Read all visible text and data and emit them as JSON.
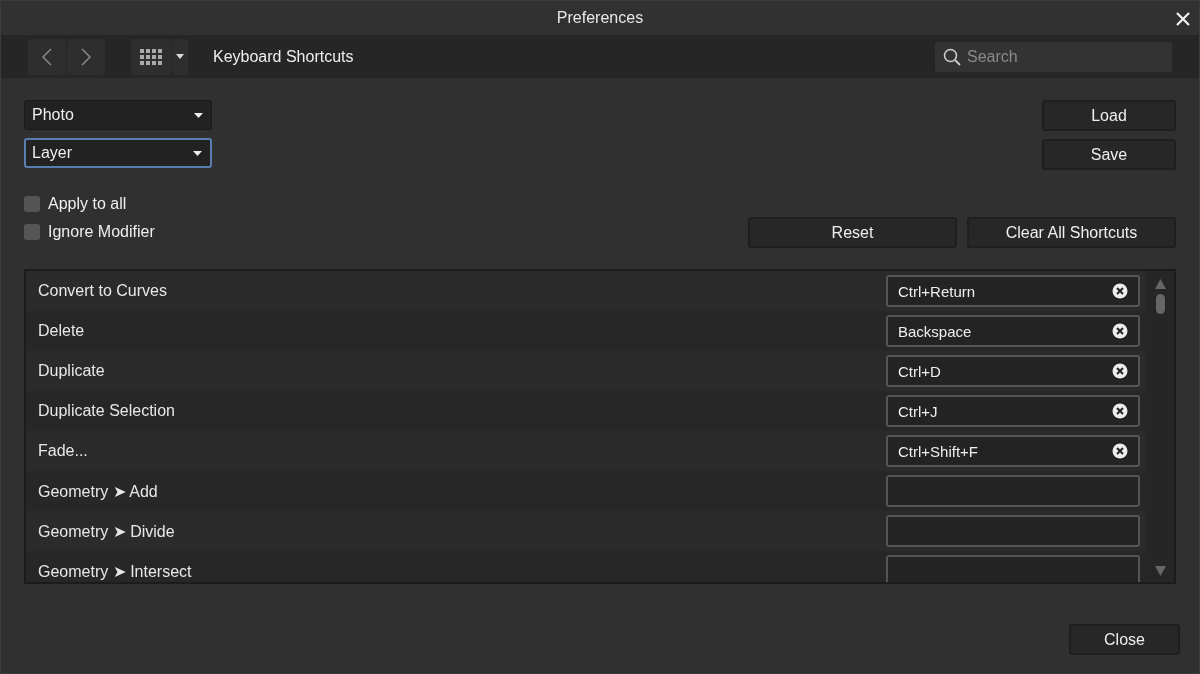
{
  "window": {
    "title": "Preferences"
  },
  "toolbar": {
    "section_title": "Keyboard Shortcuts",
    "search": {
      "placeholder": "Search"
    }
  },
  "dropdowns": [
    {
      "value": "Photo",
      "focused": false
    },
    {
      "value": "Layer",
      "focused": true
    }
  ],
  "checkboxes": [
    {
      "label": "Apply to all",
      "checked": false
    },
    {
      "label": "Ignore Modifier",
      "checked": false
    }
  ],
  "buttons": {
    "load": "Load",
    "save": "Save",
    "reset": "Reset",
    "clear_all": "Clear All Shortcuts",
    "close": "Close"
  },
  "shortcuts": [
    {
      "command": "Convert to Curves",
      "shortcut": "Ctrl+Return"
    },
    {
      "command": "Delete",
      "shortcut": "Backspace"
    },
    {
      "command": "Duplicate",
      "shortcut": "Ctrl+D"
    },
    {
      "command": "Duplicate Selection",
      "shortcut": "Ctrl+J"
    },
    {
      "command": "Fade...",
      "shortcut": "Ctrl+Shift+F"
    },
    {
      "command": "Geometry ➤ Add"
    },
    {
      "command": "Geometry ➤ Divide"
    },
    {
      "command": "Geometry ➤ Intersect"
    }
  ]
}
